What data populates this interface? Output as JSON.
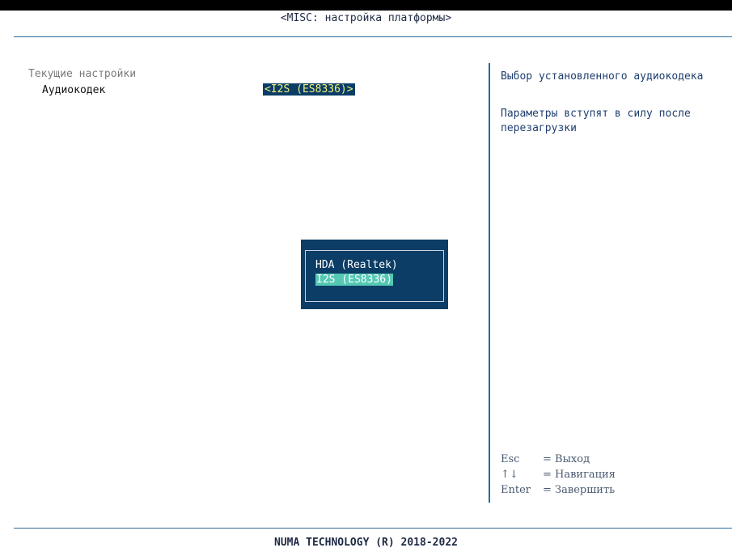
{
  "header": {
    "title": "<MISC: настройка платформы>"
  },
  "settings": {
    "section_title": "Текущие настройки",
    "items": [
      {
        "label": "Аудиокодек",
        "value": "<I2S (ES8336)>"
      }
    ]
  },
  "help": {
    "line1": "Выбор установленного аудиокодека",
    "line2": "Параметры вступят в силу после",
    "line3": "перезагрузки"
  },
  "keys": [
    {
      "key": "Esc",
      "action": "= Выход"
    },
    {
      "key": "↑↓",
      "action": "= Навигация"
    },
    {
      "key": "Enter",
      "action": "= Завершить"
    }
  ],
  "popup": {
    "options": [
      {
        "label": "HDA (Realtek)",
        "selected": false
      },
      {
        "label": "I2S (ES8336)",
        "selected": true
      }
    ]
  },
  "footer": {
    "text": "NUMA TECHNOLOGY (R) 2018-2022"
  },
  "colors": {
    "accent": "#0b3d66",
    "highlight_value": "#f2f27a",
    "selected_option": "#55c8b4",
    "rule": "#2b6b9c"
  }
}
